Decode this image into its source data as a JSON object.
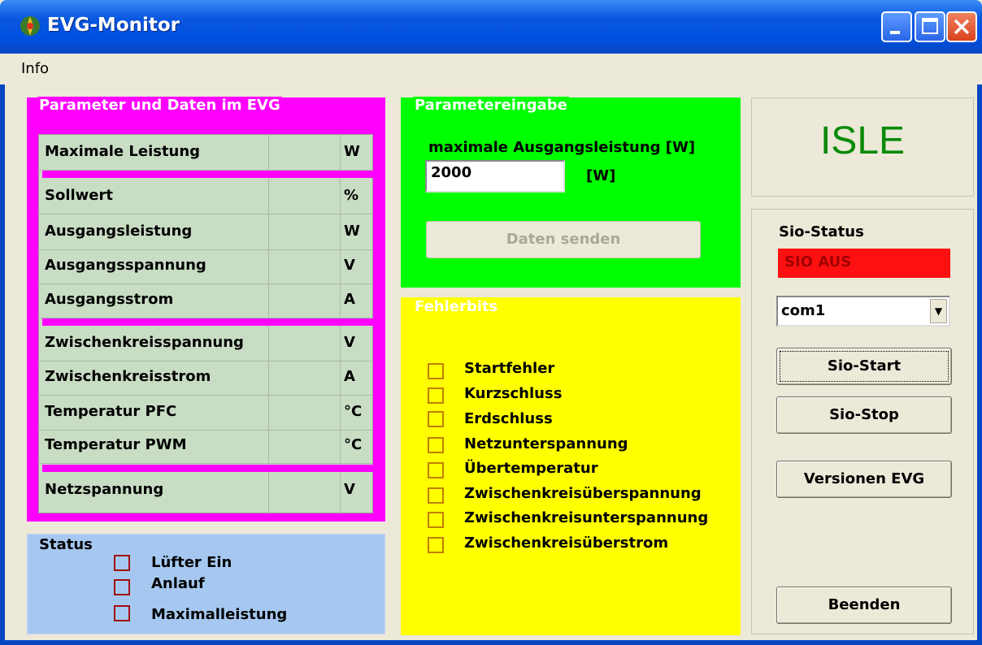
{
  "window": {
    "title": "EVG-Monitor"
  },
  "menu": {
    "info": "Info"
  },
  "params": {
    "title": "Parameter und Daten im EVG",
    "rows": [
      {
        "name": "Maximale Leistung",
        "value": "",
        "unit": "W"
      },
      {
        "name": "Sollwert",
        "value": "",
        "unit": "%"
      },
      {
        "name": "Ausgangsleistung",
        "value": "",
        "unit": "W"
      },
      {
        "name": "Ausgangsspannung",
        "value": "",
        "unit": "V"
      },
      {
        "name": "Ausgangsstrom",
        "value": "",
        "unit": "A"
      },
      {
        "name": "Zwischenkreisspannung",
        "value": "",
        "unit": "V"
      },
      {
        "name": "Zwischenkreisstrom",
        "value": "",
        "unit": "A"
      },
      {
        "name": "Temperatur PFC",
        "value": "",
        "unit": "°C"
      },
      {
        "name": "Temperatur PWM",
        "value": "",
        "unit": "°C"
      },
      {
        "name": "Netzspannung",
        "value": "",
        "unit": "V"
      }
    ]
  },
  "status": {
    "title": "Status",
    "items": [
      "Lüfter Ein",
      "Anlauf",
      "Maximalleistung"
    ]
  },
  "input": {
    "title": "Parametereingabe",
    "max_label": "maximale Ausgangsleistung [W]",
    "max_value": "2000",
    "unit": "[W]",
    "send_label": "Daten senden"
  },
  "fehler": {
    "title": "Fehlerbits",
    "items": [
      "Startfehler",
      "Kurzschluss",
      "Erdschluss",
      "Netzunterspannung",
      "Übertemperatur",
      "Zwischenkreisüberspannung",
      "Zwischenkreisunterspannung",
      "Zwischenkreisüberstrom"
    ]
  },
  "right": {
    "brand": "ISLE",
    "sio_label": "Sio-Status",
    "sio_status": "SIO AUS",
    "port": "com1",
    "start_label": "Sio-Start",
    "stop_label": "Sio-Stop",
    "versions_label": "Versionen EVG",
    "quit_label": "Beenden"
  },
  "colors": {
    "param_bg": "#ff00ff",
    "input_bg": "#00ff00",
    "fehler_bg": "#ffff00",
    "status_bg": "#a6c8f0",
    "sio_off": "#ff1010",
    "brand": "#0a8a0a"
  }
}
